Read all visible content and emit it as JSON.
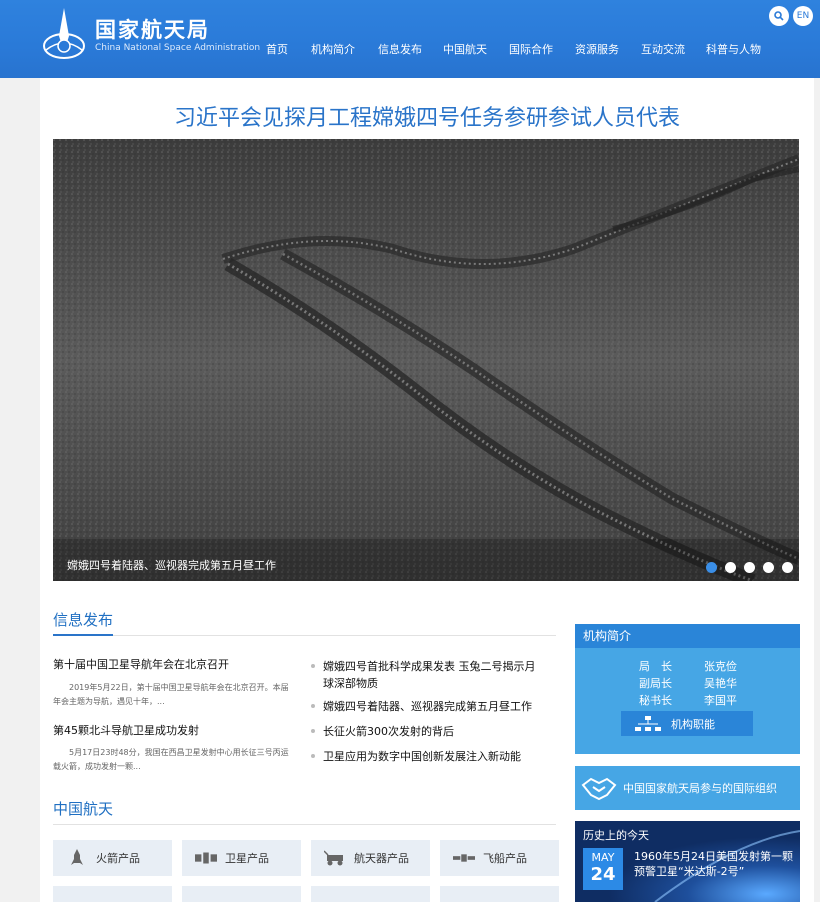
{
  "header": {
    "logo_cn": "国家航天局",
    "logo_en": "China National Space Administration",
    "lang_label": "EN",
    "nav": [
      "首页",
      "机构简介",
      "信息发布",
      "中国航天",
      "国际合作",
      "资源服务",
      "互动交流",
      "科普与人物"
    ]
  },
  "headline": "习近平会见探月工程嫦娥四号任务参研参试人员代表",
  "hero": {
    "caption": "嫦娥四号着陆器、巡视器完成第五月昼工作",
    "slides": 5,
    "active_slide": 1
  },
  "info": {
    "title": "信息发布",
    "featured": [
      {
        "title": "第十届中国卫星导航年会在北京召开",
        "summary": "2019年5月22日，第十届中国卫星导航年会在北京召开。本届年会主题为导航，遇见十年，..."
      },
      {
        "title": "第45颗北斗导航卫星成功发射",
        "summary": "5月17日23时48分，我国在西昌卫星发射中心用长征三号丙运载火箭，成功发射一颗..."
      }
    ],
    "list": [
      "嫦娥四号首批科学成果发表 玉兔二号揭示月球深部物质",
      "嫦娥四号着陆器、巡视器完成第五月昼工作",
      "长征火箭300次发射的背后",
      "卫星应用为数字中国创新发展注入新动能"
    ]
  },
  "china_space": {
    "title": "中国航天",
    "products": [
      {
        "label": "火箭产品",
        "icon": "rocket-icon"
      },
      {
        "label": "卫星产品",
        "icon": "satellite-icon"
      },
      {
        "label": "航天器产品",
        "icon": "rover-icon"
      },
      {
        "label": "飞船产品",
        "icon": "spaceship-icon"
      }
    ]
  },
  "org": {
    "title": "机构简介",
    "rows": [
      {
        "role": "局　长",
        "name": "张克俭"
      },
      {
        "role": "副局长",
        "name": "吴艳华"
      },
      {
        "role": "秘书长",
        "name": "李国平"
      }
    ],
    "function_label": "机构职能"
  },
  "intl": {
    "label": "中国国家航天局参与的国际组织"
  },
  "history": {
    "title": "历史上的今天",
    "month": "MAY",
    "day": "24",
    "text": "1960年5月24日美国发射第一颗预警卫星“米达斯-2号”"
  },
  "colors": {
    "brand_blue": "#2a7ad8",
    "accent_blue": "#2a74c9",
    "panel_blue": "#46a6e5",
    "history_bg": "#0f2d63"
  }
}
